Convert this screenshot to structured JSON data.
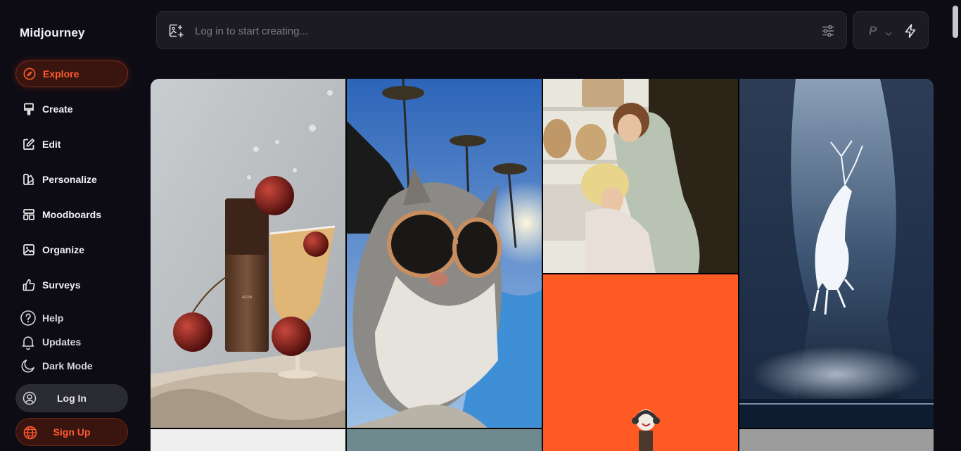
{
  "brand": {
    "name": "Midjourney"
  },
  "sidebar": {
    "items": [
      {
        "label": "Explore",
        "icon": "compass-icon",
        "active": true
      },
      {
        "label": "Create",
        "icon": "brush-icon"
      },
      {
        "label": "Edit",
        "icon": "edit-icon"
      },
      {
        "label": "Personalize",
        "icon": "palette-icon"
      },
      {
        "label": "Moodboards",
        "icon": "moodboard-icon"
      },
      {
        "label": "Organize",
        "icon": "image-icon"
      },
      {
        "label": "Surveys",
        "icon": "thumbs-up-icon"
      }
    ],
    "secondary": [
      {
        "label": "Help",
        "icon": "help-icon"
      },
      {
        "label": "Updates",
        "icon": "bell-icon"
      },
      {
        "label": "Dark Mode",
        "icon": "moon-icon"
      }
    ],
    "login_label": "Log In",
    "signup_label": "Sign Up"
  },
  "search": {
    "placeholder": "Log in to start creating..."
  },
  "mode": {
    "personalize_label": "P"
  },
  "colors": {
    "accent": "#ff5a2e",
    "background": "#0d0c14",
    "panel": "#1c1b24"
  },
  "gallery": {
    "tiles": [
      {
        "subject": "brown cosmetic bottle with cherries and cocktail glass"
      },
      {
        "subject": "cat wearing sunglasses with palm trees"
      },
      {
        "subject": "two children looking into a refrigerator"
      },
      {
        "subject": "white spirit deer leaping in a blue canyon"
      },
      {
        "subject": "small clown figure wearing headphones on orange background"
      }
    ]
  }
}
